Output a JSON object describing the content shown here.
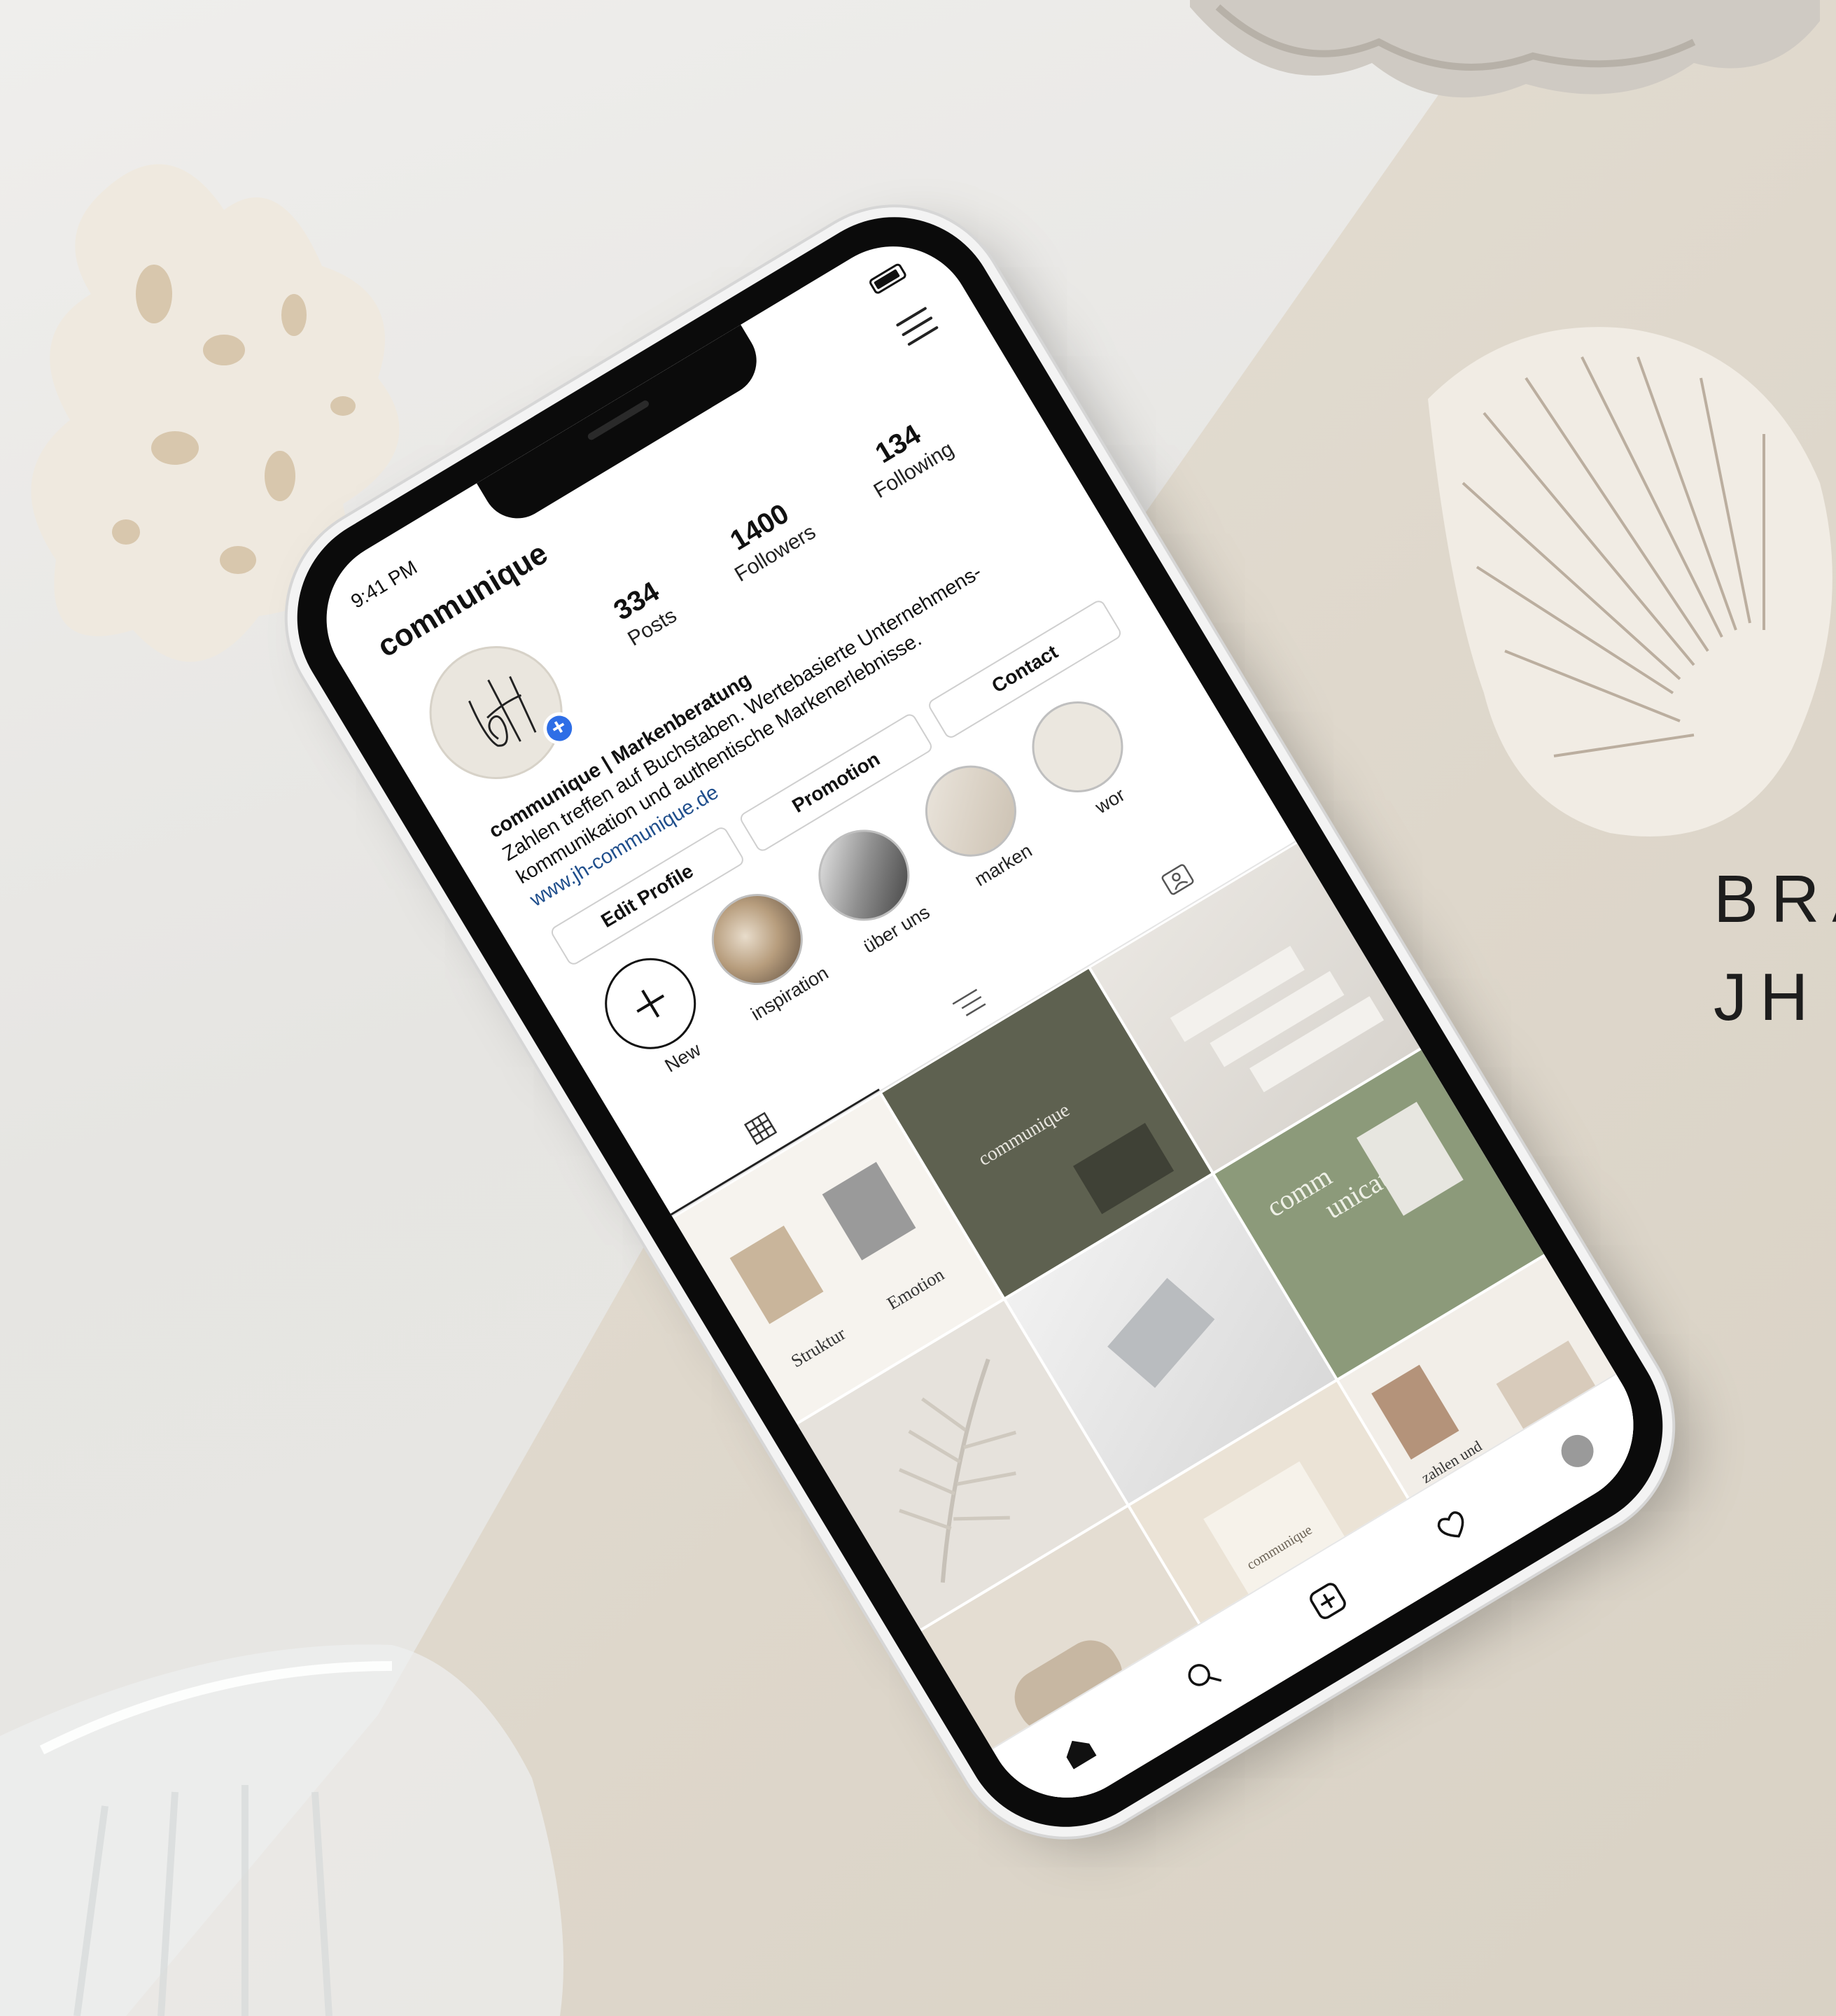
{
  "status": {
    "time": "9:41 PM"
  },
  "profile": {
    "username": "communique",
    "stats": [
      {
        "num": "334",
        "label": "Posts"
      },
      {
        "num": "1400",
        "label": "Followers"
      },
      {
        "num": "134",
        "label": "Following"
      }
    ],
    "bio_name": "communique | Markenberatung",
    "bio_line1": "Zahlen treffen auf Buchstaben. Wertebasierte Unternehmens-",
    "bio_line2": "kommunikation und authentische Markenerlebnisse.",
    "bio_link": "www.jh-communique.de"
  },
  "buttons": {
    "edit": "Edit Profile",
    "promotion": "Promotion",
    "contact": "Contact"
  },
  "highlights": [
    {
      "label": "New",
      "kind": "new"
    },
    {
      "label": "inspiration"
    },
    {
      "label": "über uns"
    },
    {
      "label": "marken"
    },
    {
      "label": "wor"
    }
  ],
  "grid_text": {
    "post1_left": "Struktur",
    "post1_right": "Emotion",
    "post2": "communique",
    "post3_top": "comm",
    "post3_bottom": "unication",
    "post6": "zahlen und buchstaben",
    "post8": "communique"
  },
  "brand": {
    "line1": "BRA",
    "line2": "JH"
  },
  "colors": {
    "accent": "#2e6ee6",
    "olive": "#8c9a7a",
    "dark_olive": "#5e6150",
    "link": "#1f4e8c"
  }
}
